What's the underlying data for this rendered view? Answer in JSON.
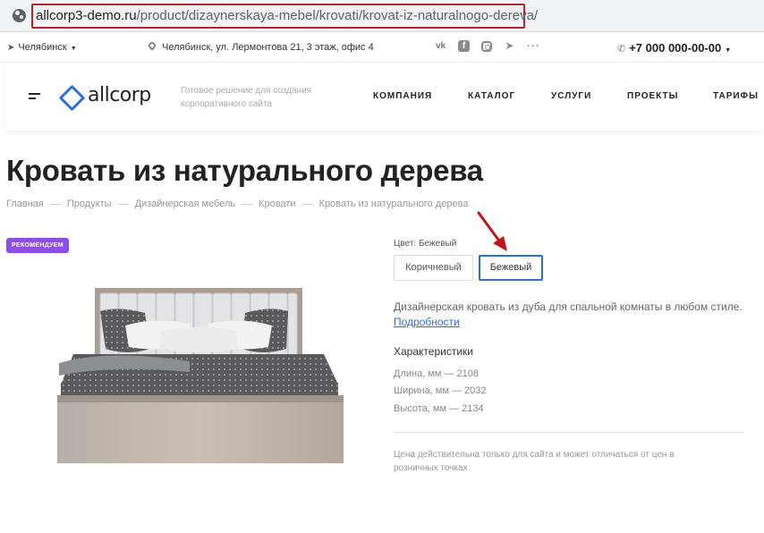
{
  "browser": {
    "url_domain": "allcorp3-demo.ru",
    "url_path": "/product/dizaynerskaya-mebel/krovati/krovat-iz-naturalnogo-dereva/"
  },
  "topbar": {
    "city": "Челябинск",
    "address": "Челябинск, ул. Лермонтова 21, 3 этаж, офис 4",
    "socials": [
      "vk-icon",
      "facebook-icon",
      "instagram-icon",
      "telegram-icon"
    ],
    "more": "···",
    "phone": "+7 000 000-00-00"
  },
  "header": {
    "logo": "allcorp",
    "slogan": "Готовое решение для создания корпоративного сайта",
    "nav": [
      "КОМПАНИЯ",
      "КАТАЛОГ",
      "УСЛУГИ",
      "ПРОЕКТЫ",
      "ТАРИФЫ"
    ]
  },
  "page": {
    "title": "Кровать из натурального дерева",
    "breadcrumbs": [
      "Главная",
      "Продукты",
      "Дизайнерская мебель",
      "Кровати",
      "Кровать из натурального дерева"
    ]
  },
  "product": {
    "badge": "РЕКОМЕНДУЕМ",
    "color_label": "Цвет: Бежевый",
    "color_options": [
      "Коричневый",
      "Бежевый"
    ],
    "selected_color": "Бежевый",
    "description": "Дизайнерская кровать из дуба для спальной комнаты в любом стиле.",
    "more_link": "Подробности",
    "characteristics_title": "Характеристики",
    "specs": [
      "Длина, мм — 2108",
      "Ширина, мм — 2032",
      "Высота, мм — 2134"
    ],
    "price_note": "Цена действительна только для сайта и может отличаться от цен в розничных точках"
  },
  "colors": {
    "accent": "#2e6fd6",
    "badge": "#8e4fe0",
    "url_highlight": "#b3262d",
    "annotation_arrow": "#c0141b"
  }
}
